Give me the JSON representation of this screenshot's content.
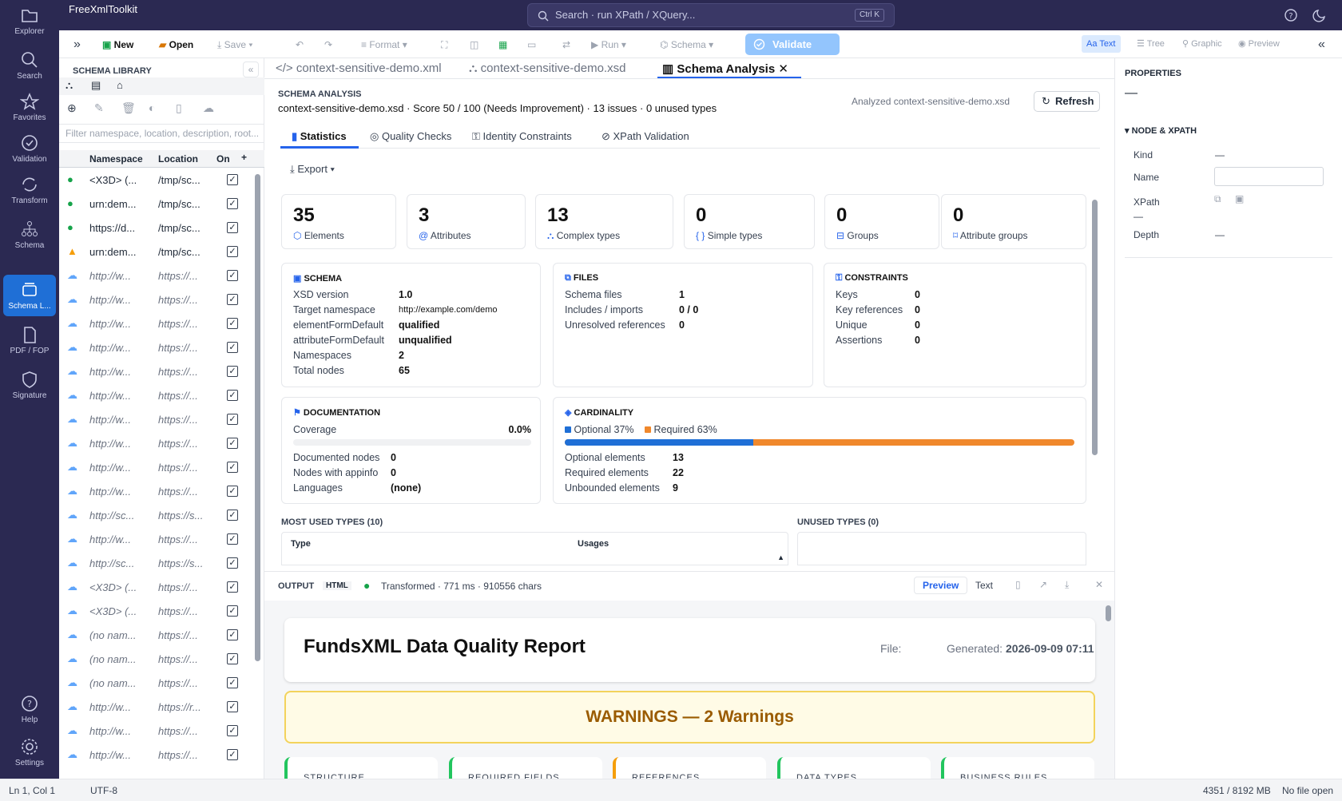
{
  "app": {
    "name": "FreeXmlToolkit"
  },
  "search": {
    "placeholder": "Search · run XPath / XQuery...",
    "shortcut": "Ctrl K"
  },
  "rail": {
    "items": [
      {
        "label": "Explorer",
        "icon": "folder-icon"
      },
      {
        "label": "Search",
        "icon": "search-icon"
      },
      {
        "label": "Favorites",
        "icon": "star-icon"
      },
      {
        "label": "Validation",
        "icon": "check-circle-icon"
      },
      {
        "label": "Transform",
        "icon": "refresh-icon"
      },
      {
        "label": "Schema",
        "icon": "tree-icon"
      },
      {
        "label": "Schema L...",
        "icon": "library-icon",
        "active": true
      },
      {
        "label": "PDF / FOP",
        "icon": "pdf-icon"
      },
      {
        "label": "Signature",
        "icon": "shield-icon"
      }
    ],
    "bottom": [
      {
        "label": "Help",
        "icon": "help-icon"
      },
      {
        "label": "Settings",
        "icon": "gear-icon"
      }
    ]
  },
  "toolbar": {
    "new": "New",
    "open": "Open",
    "save": "Save",
    "format": "Format",
    "run": "Run",
    "schema": "Schema",
    "validate": "Validate",
    "views": [
      "Text",
      "Tree",
      "Graphic",
      "Preview"
    ]
  },
  "library": {
    "title": "SCHEMA LIBRARY",
    "filter_placeholder": "Filter namespace, location, description, root...",
    "columns": [
      "Namespace",
      "Location",
      "On"
    ],
    "rows": [
      {
        "status": "ok",
        "ns": "<X3D> (...",
        "loc": "/tmp/sc..."
      },
      {
        "status": "ok",
        "ns": "urn:dem...",
        "loc": "/tmp/sc..."
      },
      {
        "status": "ok",
        "ns": "https://d...",
        "loc": "/tmp/sc..."
      },
      {
        "status": "warn",
        "ns": "urn:dem...",
        "loc": "/tmp/sc..."
      },
      {
        "status": "remote",
        "ns": "http://w...",
        "loc": "https://..."
      },
      {
        "status": "remote",
        "ns": "http://w...",
        "loc": "https://..."
      },
      {
        "status": "remote",
        "ns": "http://w...",
        "loc": "https://..."
      },
      {
        "status": "remote",
        "ns": "http://w...",
        "loc": "https://..."
      },
      {
        "status": "remote",
        "ns": "http://w...",
        "loc": "https://..."
      },
      {
        "status": "remote",
        "ns": "http://w...",
        "loc": "https://..."
      },
      {
        "status": "remote",
        "ns": "http://w...",
        "loc": "https://..."
      },
      {
        "status": "remote",
        "ns": "http://w...",
        "loc": "https://..."
      },
      {
        "status": "remote",
        "ns": "http://w...",
        "loc": "https://..."
      },
      {
        "status": "remote",
        "ns": "http://w...",
        "loc": "https://..."
      },
      {
        "status": "remote",
        "ns": "http://sc...",
        "loc": "https://s..."
      },
      {
        "status": "remote",
        "ns": "http://w...",
        "loc": "https://..."
      },
      {
        "status": "remote",
        "ns": "http://sc...",
        "loc": "https://s..."
      },
      {
        "status": "remote",
        "ns": "<X3D> (...",
        "loc": "https://..."
      },
      {
        "status": "remote",
        "ns": "<X3D> (...",
        "loc": "https://..."
      },
      {
        "status": "remote",
        "ns": "(no nam...",
        "loc": "https://..."
      },
      {
        "status": "remote",
        "ns": "(no nam...",
        "loc": "https://..."
      },
      {
        "status": "remote",
        "ns": "(no nam...",
        "loc": "https://..."
      },
      {
        "status": "remote",
        "ns": "http://w...",
        "loc": "https://r..."
      },
      {
        "status": "remote",
        "ns": "http://w...",
        "loc": "https://..."
      },
      {
        "status": "remote",
        "ns": "http://w...",
        "loc": "https://..."
      }
    ]
  },
  "tabs": [
    {
      "label": "context-sensitive-demo.xml"
    },
    {
      "label": "context-sensitive-demo.xsd"
    },
    {
      "label": "Schema Analysis",
      "active": true
    }
  ],
  "analysis": {
    "heading": "SCHEMA ANALYSIS",
    "subtitle": "context-sensitive-demo.xsd · Score 50 / 100 (Needs Improvement) · 13 issues · 0 unused types",
    "analyzed": "Analyzed context-sensitive-demo.xsd",
    "refresh": "Refresh",
    "subtabs": [
      "Statistics",
      "Quality Checks",
      "Identity Constraints",
      "XPath Validation"
    ],
    "export": "Export",
    "stats": [
      {
        "value": "35",
        "label": "Elements"
      },
      {
        "value": "3",
        "label": "Attributes"
      },
      {
        "value": "13",
        "label": "Complex types"
      },
      {
        "value": "0",
        "label": "Simple types"
      },
      {
        "value": "0",
        "label": "Groups"
      },
      {
        "value": "0",
        "label": "Attribute groups"
      }
    ],
    "schema": {
      "title": "SCHEMA",
      "rows": [
        [
          "XSD version",
          "1.0"
        ],
        [
          "Target namespace",
          "http://example.com/demo"
        ],
        [
          "elementFormDefault",
          "qualified"
        ],
        [
          "attributeFormDefault",
          "unqualified"
        ],
        [
          "Namespaces",
          "2"
        ],
        [
          "Total nodes",
          "65"
        ]
      ]
    },
    "files": {
      "title": "FILES",
      "rows": [
        [
          "Schema files",
          "1"
        ],
        [
          "Includes / imports",
          "0 / 0"
        ],
        [
          "Unresolved references",
          "0"
        ]
      ]
    },
    "constraints": {
      "title": "CONSTRAINTS",
      "rows": [
        [
          "Keys",
          "0"
        ],
        [
          "Key references",
          "0"
        ],
        [
          "Unique",
          "0"
        ],
        [
          "Assertions",
          "0"
        ]
      ]
    },
    "documentation": {
      "title": "DOCUMENTATION",
      "coverage_label": "Coverage",
      "coverage": "0.0%",
      "coverage_fraction": 0.0,
      "rows": [
        [
          "Documented nodes",
          "0"
        ],
        [
          "Nodes with appinfo",
          "0"
        ],
        [
          "Languages",
          "(none)"
        ]
      ]
    },
    "cardinality": {
      "title": "CARDINALITY",
      "optional_legend": "Optional 37%",
      "required_legend": "Required 63%",
      "optional_fraction": 0.37,
      "optional_color": "#1f6fd6",
      "required_color": "#f0882c",
      "rows": [
        [
          "Optional elements",
          "13"
        ],
        [
          "Required elements",
          "22"
        ],
        [
          "Unbounded elements",
          "9"
        ]
      ]
    },
    "most_used": {
      "title": "MOST USED TYPES (10)",
      "columns": [
        "Type",
        "Usages"
      ]
    },
    "unused": {
      "title": "UNUSED TYPES (0)"
    }
  },
  "properties": {
    "title": "PROPERTIES",
    "dash": "—",
    "section": "NODE & XPATH",
    "kind_label": "Kind",
    "kind_value": "—",
    "name_label": "Name",
    "xpath_label": "XPath",
    "xpath_value": "—",
    "depth_label": "Depth",
    "depth_value": "—"
  },
  "output": {
    "title": "OUTPUT",
    "badge": "HTML",
    "status": "Transformed · 771 ms · 910556 chars",
    "preview": "Preview",
    "text": "Text",
    "report": {
      "title": "FundsXML Data Quality Report",
      "file_label": "File:",
      "generated_label": "Generated:",
      "generated": "2026-09-09 07:11",
      "warnings": "WARNINGS — 2 Warnings",
      "categories": [
        "STRUCTURE",
        "REQUIRED FIELDS",
        "REFERENCES",
        "DATA TYPES",
        "BUSINESS RULES"
      ]
    }
  },
  "status": {
    "position": "Ln 1, Col 1",
    "encoding": "UTF-8",
    "memory": "4351 / 8192 MB",
    "file": "No file open"
  }
}
